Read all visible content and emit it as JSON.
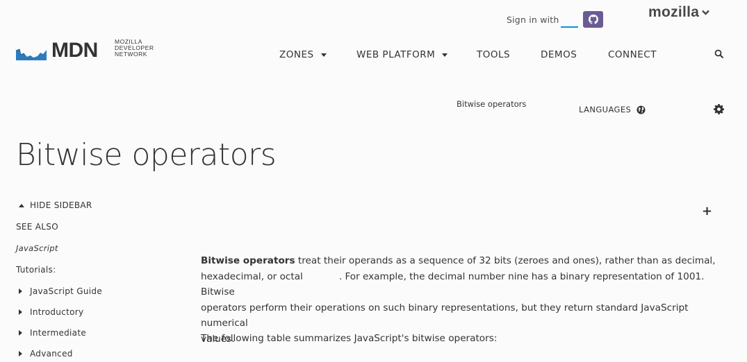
{
  "header": {
    "sign_in_text": "Sign in with",
    "github_icon": "github-icon",
    "mozilla_label": "mozilla",
    "mozilla_chevron": "⌄",
    "logo": {
      "mdn": "MDN",
      "sub_line1": "MOZILLA",
      "sub_line2": "DEVELOPER",
      "sub_line3": "NETWORK"
    },
    "nav": [
      {
        "label": "ZONES",
        "has_caret": true
      },
      {
        "label": "WEB PLATFORM",
        "has_caret": true
      },
      {
        "label": "TOOLS",
        "has_caret": false
      },
      {
        "label": "DEMOS",
        "has_caret": false
      },
      {
        "label": "CONNECT",
        "has_caret": false
      }
    ],
    "search_icon": "search-icon"
  },
  "breadcrumb": {
    "current": "Bitwise operators"
  },
  "languages_label": "LANGUAGES",
  "page_title": "Bitwise operators",
  "sidebar": {
    "hide_label": "HIDE SIDEBAR",
    "see_also": "SEE ALSO",
    "js_link": "JavaScript",
    "tutorials_label": "Tutorials:",
    "items": [
      {
        "label": "JavaScript Guide"
      },
      {
        "label": "Introductory"
      },
      {
        "label": "Intermediate"
      },
      {
        "label": "Advanced"
      }
    ]
  },
  "article": {
    "intro_bold": "Bitwise operators",
    "intro_rest_1": " treat their operands as a sequence of 32 bits (zeroes and ones), rather than as decimal,",
    "intro_line2_a": "hexadecimal, or octal",
    "intro_line2_b": ". For example, the decimal number nine has a binary representation of 1001. Bitwise",
    "intro_line3": "operators perform their operations on such binary representations, but they return standard JavaScript numerical",
    "intro_line4": "values.",
    "table_intro": "The following table summarizes JavaScript's bitwise operators:"
  },
  "colors": {
    "accent_blue": "#0095dd",
    "github_purple": "#6b5b95",
    "logo_blue": "#2d7bbb",
    "text": "#333333"
  }
}
